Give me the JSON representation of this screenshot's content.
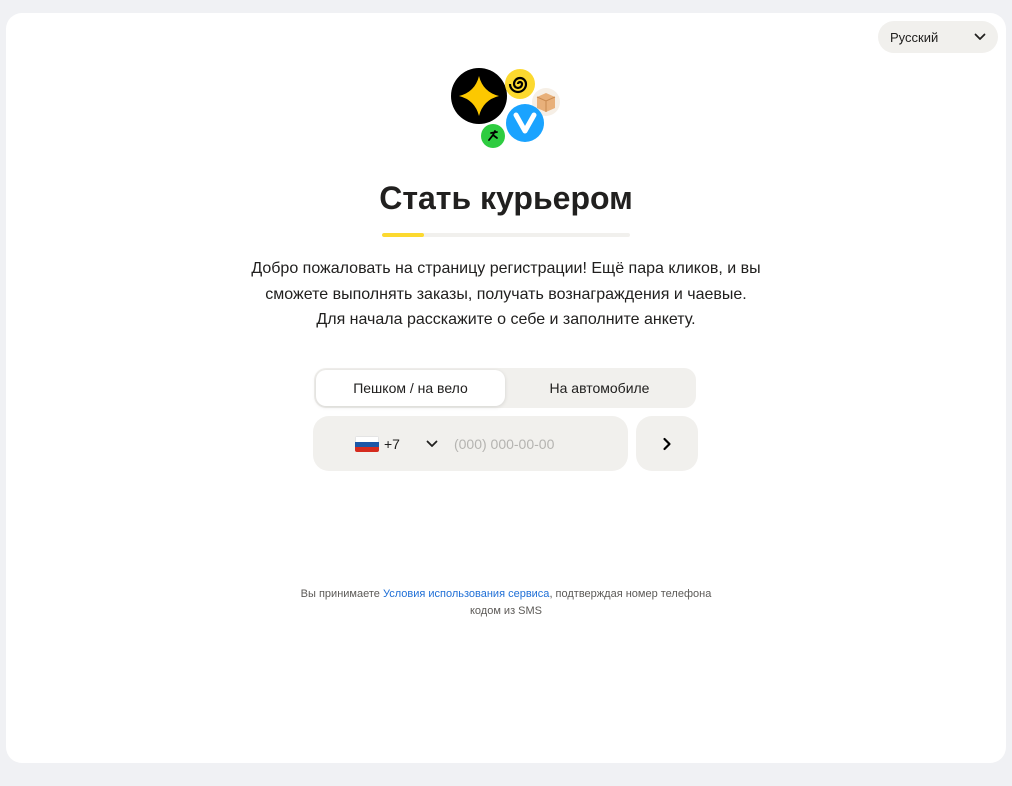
{
  "language": {
    "selected": "Русский"
  },
  "header": {
    "title": "Стать курьером"
  },
  "progress": {
    "value": 0.17,
    "color": "#fcd92f"
  },
  "intro": {
    "line1": "Добро пожаловать на страницу регистрации! Ещё пара кликов, и вы",
    "line2": "сможете выполнять заказы, получать вознаграждения и чаевые.",
    "line3": "Для начала расскажите о себе и заполните анкету."
  },
  "mode_tabs": [
    {
      "label": "Пешком / на вело",
      "active": true
    },
    {
      "label": "На автомобиле",
      "active": false
    }
  ],
  "phone": {
    "country_code": "+7",
    "placeholder": "(000) 000-00-00",
    "value": ""
  },
  "terms": {
    "prefix": "Вы принимаете ",
    "link": "Условия использования сервиса",
    "suffix_line1": ", подтверждая номер телефона",
    "suffix_line2": "кодом из SMS"
  },
  "colors": {
    "accent": "#fcd92f",
    "link": "#1f6fd6",
    "field_bg": "#f1f0ed",
    "page_bg": "#f0f1f4"
  },
  "icons": {
    "language_chevron": "chevron-down-icon",
    "country_flag": "russia-flag-icon",
    "country_chevron": "chevron-down-icon",
    "next": "chevron-right-icon",
    "logo": "courier-services-logo"
  }
}
